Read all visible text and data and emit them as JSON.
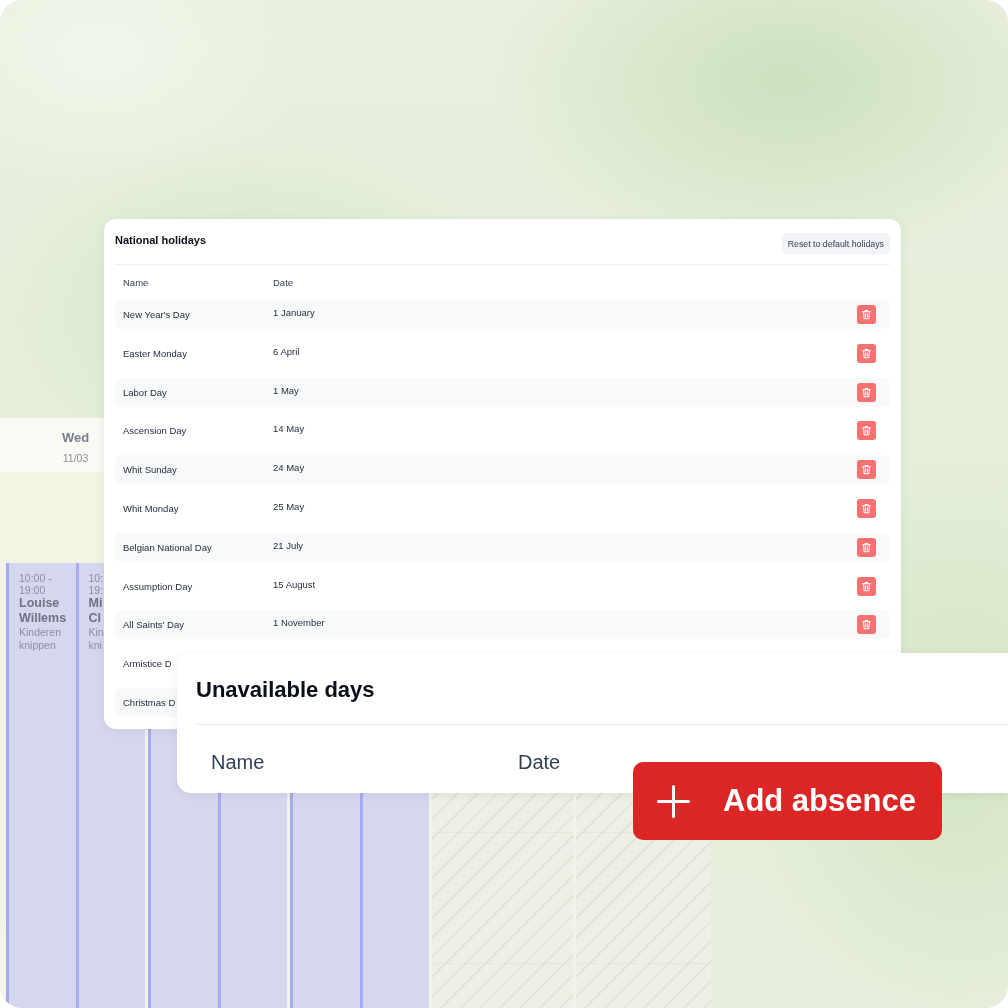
{
  "calendar": {
    "days": [
      {
        "kind": "shifts",
        "weekday": "Wed",
        "date": "11/03",
        "events": [
          {
            "kind": "shift",
            "time": "10:00 - 19:00",
            "name": "Louise Willems",
            "note": "Kinderen knippen"
          },
          {
            "kind": "shift",
            "time": "10:\n19:",
            "name": "Mi\nCl",
            "note": "Kin\nkni"
          }
        ]
      },
      {
        "kind": "shifts",
        "events": [
          {
            "kind": "shift"
          },
          {
            "kind": "shift"
          }
        ]
      },
      {
        "kind": "shifts",
        "events": [
          {
            "kind": "shift"
          },
          {
            "kind": "shift"
          }
        ]
      },
      {
        "kind": "unavailable"
      },
      {
        "kind": "unavailable"
      }
    ]
  },
  "national_holidays": {
    "title": "National holidays",
    "reset_button": "Reset to default holidays",
    "columns": [
      "Name",
      "Date"
    ],
    "rows": [
      {
        "name": "New Year's Day",
        "date": "1 January"
      },
      {
        "name": "Easter Monday",
        "date": "6 April"
      },
      {
        "name": "Labor Day",
        "date": "1 May"
      },
      {
        "name": "Ascension Day",
        "date": "14 May"
      },
      {
        "name": "Whit Sunday",
        "date": "24 May"
      },
      {
        "name": "Whit Monday",
        "date": "25 May"
      },
      {
        "name": "Belgian National Day",
        "date": "21 July"
      },
      {
        "name": "Assumption Day",
        "date": "15 August"
      },
      {
        "name": "All Saints' Day",
        "date": "1 November"
      },
      {
        "name": "Armistice D"
      },
      {
        "name": "Christmas D"
      }
    ]
  },
  "unavailable_days": {
    "title": "Unavailable days",
    "columns": [
      "Name",
      "Date"
    ],
    "add_button": "Add absence"
  }
}
